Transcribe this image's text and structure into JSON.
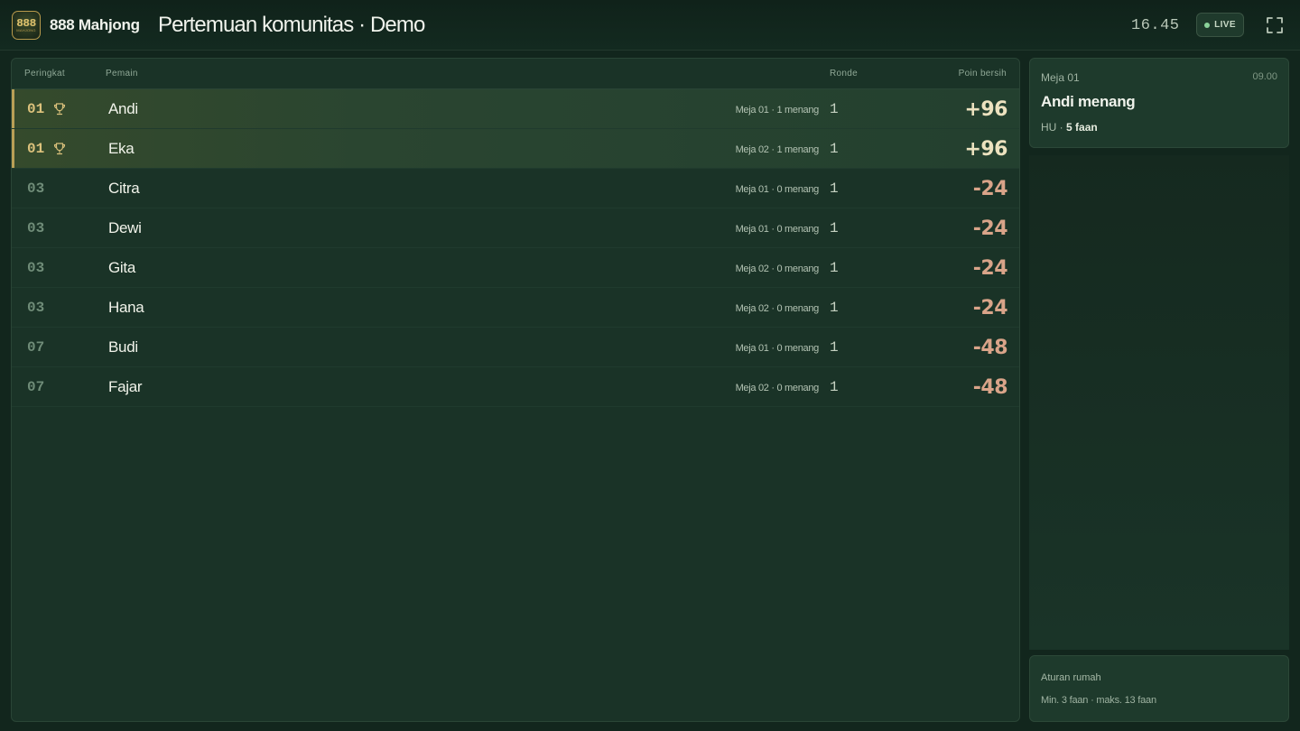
{
  "header": {
    "logo_number": "888",
    "logo_subtext": "MAHJONG",
    "brand": "888 Mahjong",
    "title": "Pertemuan komunitas · Demo",
    "clock": "16.45",
    "live_label": "LIVE",
    "fullscreen_icon": "fullscreen-icon"
  },
  "leaderboard": {
    "columns": {
      "rank": "Peringkat",
      "player": "Pemain",
      "rounds": "Ronde",
      "points": "Poin bersih"
    },
    "rows": [
      {
        "rank": "01",
        "leader": true,
        "player": "Andi",
        "meta": "Meja 01 · 1 menang",
        "rounds": "1",
        "points": "+96"
      },
      {
        "rank": "01",
        "leader": true,
        "player": "Eka",
        "meta": "Meja 02 · 1 menang",
        "rounds": "1",
        "points": "+96"
      },
      {
        "rank": "03",
        "leader": false,
        "player": "Citra",
        "meta": "Meja 01 · 0 menang",
        "rounds": "1",
        "points": "-24"
      },
      {
        "rank": "03",
        "leader": false,
        "player": "Dewi",
        "meta": "Meja 01 · 0 menang",
        "rounds": "1",
        "points": "-24"
      },
      {
        "rank": "03",
        "leader": false,
        "player": "Gita",
        "meta": "Meja 02 · 0 menang",
        "rounds": "1",
        "points": "-24"
      },
      {
        "rank": "03",
        "leader": false,
        "player": "Hana",
        "meta": "Meja 02 · 0 menang",
        "rounds": "1",
        "points": "-24"
      },
      {
        "rank": "07",
        "leader": false,
        "player": "Budi",
        "meta": "Meja 01 · 0 menang",
        "rounds": "1",
        "points": "-48"
      },
      {
        "rank": "07",
        "leader": false,
        "player": "Fajar",
        "meta": "Meja 02 · 0 menang",
        "rounds": "1",
        "points": "-48"
      }
    ]
  },
  "event": {
    "table": "Meja 01",
    "time": "09.00",
    "title": "Andi menang",
    "detail_prefix": "HU ·",
    "detail_value": "5 faan"
  },
  "house_rules": {
    "title": "Aturan rumah",
    "text": "Min. 3 faan · maks. 13 faan"
  },
  "colors": {
    "background": "#12261d",
    "accent_gold": "#dcc27c",
    "positive": "#ece2bf",
    "negative": "#d9a489",
    "live": "#8ad29a"
  }
}
